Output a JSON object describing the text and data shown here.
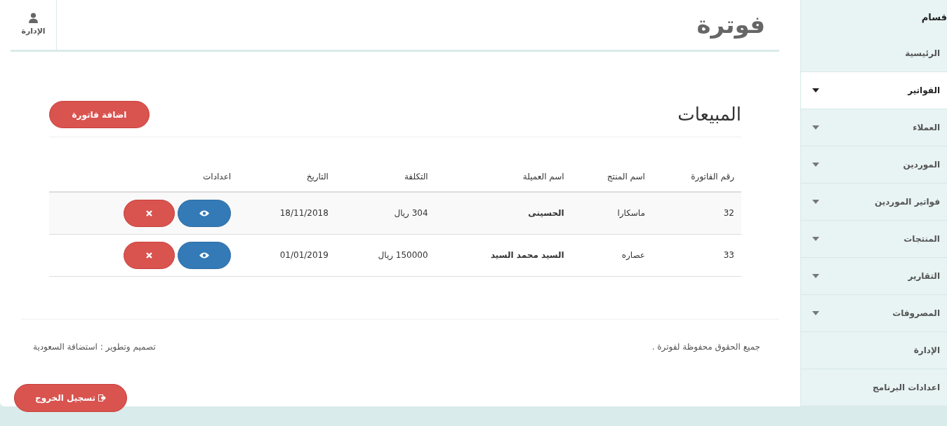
{
  "header": {
    "title": "فوترة",
    "user_label": "الإدارة"
  },
  "sidebar": {
    "heading": "قسام",
    "items": [
      {
        "label": "الرئيسية",
        "selected": false,
        "dropdown": false
      },
      {
        "label": "الفواتير",
        "selected": true,
        "dropdown": true
      },
      {
        "label": "العملاء",
        "selected": false,
        "dropdown": true
      },
      {
        "label": "الموردين",
        "selected": false,
        "dropdown": true
      },
      {
        "label": "فواتير الموردين",
        "selected": false,
        "dropdown": true
      },
      {
        "label": "المنتجات",
        "selected": false,
        "dropdown": true
      },
      {
        "label": "التقارير",
        "selected": false,
        "dropdown": true
      },
      {
        "label": "المصروفات",
        "selected": false,
        "dropdown": true
      },
      {
        "label": "الإدارة",
        "selected": false,
        "dropdown": false
      },
      {
        "label": "اعدادات البرنامج",
        "selected": false,
        "dropdown": false
      }
    ]
  },
  "section": {
    "title": "المبيعات",
    "add_button": "اضافة فاتورة"
  },
  "table": {
    "columns": [
      "رقم الفاتورة",
      "اسم المنتج",
      "اسم العميلة",
      "التكلفة",
      "التاريخ",
      "اعدادات"
    ],
    "rows": [
      {
        "number": "32",
        "product": "ماسكارا",
        "customer": "الحسينى",
        "cost": "304 ريال",
        "date": "18/11/2018"
      },
      {
        "number": "33",
        "product": "عصاره",
        "customer": "السيد محمد السيد",
        "cost": "150000 ريال",
        "date": "01/01/2019"
      }
    ]
  },
  "footer": {
    "copyright": "جميع الحقوق محفوظة لفوترة .",
    "credit": "تصميم وتطوير : استضافة السعودية"
  },
  "logout_button": "تسجيل الخروج"
}
